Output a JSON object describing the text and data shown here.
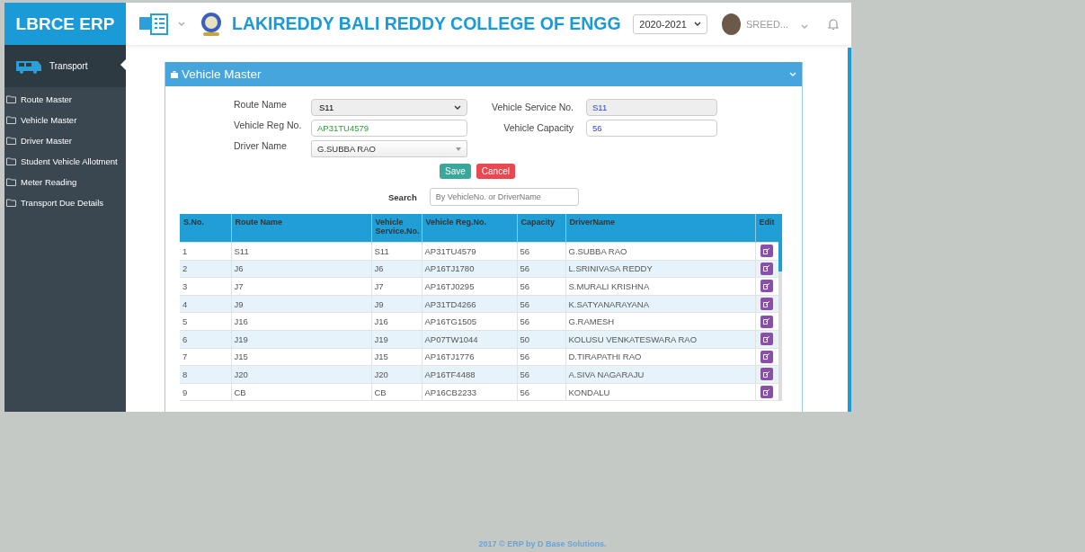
{
  "header": {
    "logo": "LBRCE ERP",
    "college_name": "LAKIREDDY BALI REDDY COLLEGE OF ENGG",
    "academic_year": "2020-2021",
    "user_name": "SREED..."
  },
  "sidebar": {
    "module": "Transport",
    "items": [
      {
        "label": "Route Master"
      },
      {
        "label": "Vehicle Master"
      },
      {
        "label": "Driver Master"
      },
      {
        "label": "Student Vehicle Allotment"
      },
      {
        "label": "Meter Reading"
      },
      {
        "label": "Transport Due Details"
      }
    ]
  },
  "panel": {
    "title": "Vehicle Master",
    "fields": [
      {
        "label": "Route Name",
        "kind": "select",
        "value": "S11"
      },
      {
        "label": "Vehicle Service No.",
        "kind": "readonly",
        "value": "S11"
      },
      {
        "label": "Vehicle Reg No.",
        "kind": "text",
        "value": "AP31TU4579"
      },
      {
        "label": "Vehicle Capacity",
        "kind": "text",
        "value": "56"
      },
      {
        "label": "Driver Name",
        "kind": "combo",
        "value": "G.SUBBA RAO"
      }
    ],
    "buttons": [
      {
        "label": "Save",
        "kind": "save"
      },
      {
        "label": "Cancel",
        "kind": "cancel"
      }
    ],
    "search": {
      "label": "Search",
      "placeholder": "By VehicleNo. or DriverName"
    },
    "table": {
      "columns": [
        "S.No.",
        "Route Name",
        "Vehicle Service.No.",
        "Vehicle Reg.No.",
        "Capacity",
        "DriverName",
        "Edit"
      ],
      "rows": [
        [
          "1",
          "S11",
          "S11",
          "AP31TU4579",
          "56",
          "G.SUBBA RAO"
        ],
        [
          "2",
          "J6",
          "J6",
          "AP16TJ1780",
          "56",
          "L.SRINIVASA REDDY"
        ],
        [
          "3",
          "J7",
          "J7",
          "AP16TJ0295",
          "56",
          "S.MURALI KRISHNA"
        ],
        [
          "4",
          "J9",
          "J9",
          "AP31TD4266",
          "56",
          "K.SATYANARAYANA"
        ],
        [
          "5",
          "J16",
          "J16",
          "AP16TG1505",
          "56",
          "G.RAMESH"
        ],
        [
          "6",
          "J19",
          "J19",
          "AP07TW1044",
          "50",
          "KOLUSU VENKATESWARA RAO"
        ],
        [
          "7",
          "J15",
          "J15",
          "AP16TJ1776",
          "56",
          "D.TIRAPATHI RAO"
        ],
        [
          "8",
          "J20",
          "J20",
          "AP16TF4488",
          "56",
          "A.SIVA NAGARAJU"
        ],
        [
          "9",
          "CB",
          "CB",
          "AP16CB2233",
          "56",
          "KONDALU"
        ]
      ]
    }
  },
  "footer": "2017 © ERP by D Base Solutions."
}
